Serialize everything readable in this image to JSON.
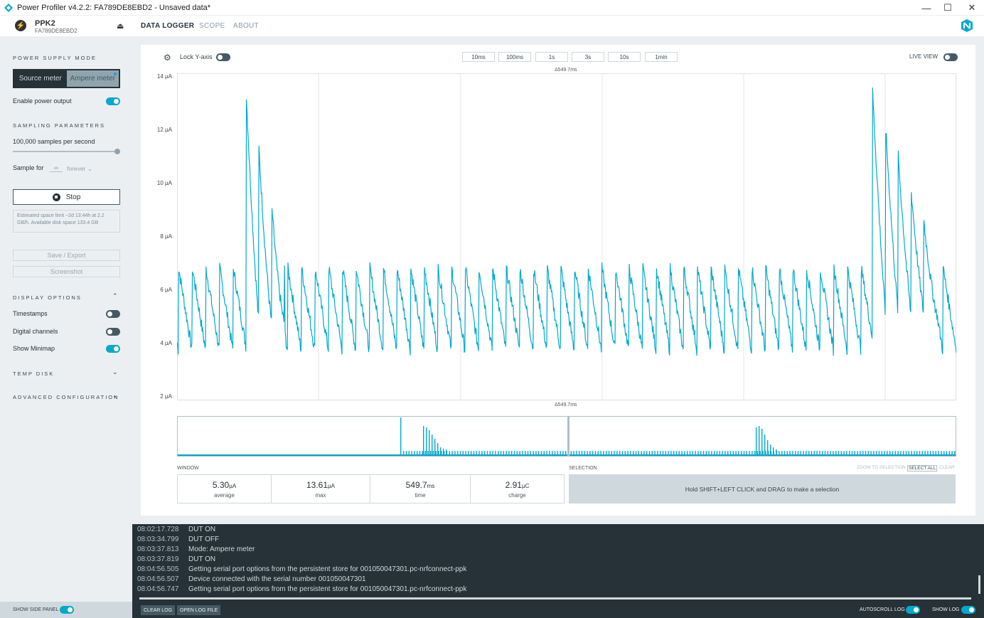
{
  "window": {
    "title": "Power Profiler v4.2.2: FA789DE8EBD2 - Unsaved data*",
    "minimize": "—",
    "maximize": "☐",
    "close": "✕"
  },
  "header": {
    "device_name": "PPK2",
    "device_serial": "FA789DE8EBD2",
    "eject": "⏏",
    "tabs": [
      {
        "label": "DATA LOGGER",
        "active": true
      },
      {
        "label": "SCOPE",
        "active": false
      },
      {
        "label": "ABOUT",
        "active": false
      }
    ]
  },
  "sidebar": {
    "power_supply_title": "POWER SUPPLY MODE",
    "mode_source": "Source meter",
    "mode_ampere": "Ampere meter",
    "enable_power_output": "Enable power output",
    "enable_power_output_on": true,
    "sampling_title": "SAMPLING PARAMETERS",
    "samples_per_second": "100,000 samples per second",
    "sample_for": "Sample for",
    "sample_for_value": "∞",
    "sample_for_unit": "forever",
    "stop_label": "Stop",
    "space_info": "Estimated space limit ~2d 13:44h at 2.2 GB/h. Available disk space 133.4 GB",
    "save_export": "Save / Export",
    "screenshot": "Screenshot",
    "display_options_title": "DISPLAY OPTIONS",
    "timestamps": "Timestamps",
    "timestamps_on": false,
    "digital_channels": "Digital channels",
    "digital_channels_on": false,
    "show_minimap": "Show Minimap",
    "show_minimap_on": true,
    "temp_disk_title": "TEMP DISK",
    "advanced_title": "ADVANCED CONFIGURATION"
  },
  "chart_toolbar": {
    "lock_y_axis": "Lock Y-axis",
    "lock_y_axis_on": false,
    "windows": [
      "10ms",
      "100ms",
      "1s",
      "3s",
      "10s",
      "1min"
    ],
    "live_view": "LIVE VIEW",
    "live_view_on": false,
    "delta_top": "Δ549.7ms",
    "delta_bottom": "Δ549.7ms"
  },
  "chart_data": {
    "type": "line",
    "title": "",
    "xlabel": "",
    "ylabel": "",
    "y_unit": "µA",
    "y_ticks": [
      "14 µA",
      "12 µA",
      "10 µA",
      "8 µA",
      "6 µA",
      "4 µA",
      "2 µA"
    ],
    "ylim": [
      2,
      14
    ],
    "x_span_ms": 549.7,
    "color": "#00a9ce",
    "description_of_pattern": "sawtooth",
    "baseline_low": 3.8,
    "baseline_high": 6.9,
    "burst_peaks": [
      13.5,
      12.0
    ]
  },
  "stats": {
    "window_title": "WINDOW",
    "average_value": "5.30",
    "average_unit": "µA",
    "average_label": "average",
    "max_value": "13.61",
    "max_unit": "µA",
    "max_label": "max",
    "time_value": "549.7",
    "time_unit": "ms",
    "time_label": "time",
    "charge_value": "2.91",
    "charge_unit": "µC",
    "charge_label": "charge",
    "selection_title": "SELECTION",
    "zoom_to_selection": "ZOOM TO SELECTION",
    "select_all": "SELECT ALL",
    "clear": "CLEAR",
    "selection_hint": "Hold SHIFT+LEFT CLICK and DRAG to make a selection"
  },
  "log": [
    {
      "time": "08:02:17.728",
      "msg": "DUT ON"
    },
    {
      "time": "08:03:34.799",
      "msg": "DUT OFF"
    },
    {
      "time": "08:03:37.813",
      "msg": "Mode: Ampere meter"
    },
    {
      "time": "08:03:37.819",
      "msg": "DUT ON"
    },
    {
      "time": "08:04:56.505",
      "msg": "Getting serial port options from the persistent store for 001050047301.pc-nrfconnect-ppk"
    },
    {
      "time": "08:04:56.507",
      "msg": "Device connected with the serial number 001050047301"
    },
    {
      "time": "08:04:56.747",
      "msg": "Getting serial port options from the persistent store for 001050047301.pc-nrfconnect-ppk"
    }
  ],
  "bottom": {
    "show_side_panel": "SHOW SIDE PANEL",
    "clear_log": "CLEAR LOG",
    "open_log_file": "OPEN LOG FILE",
    "autoscroll_log": "AUTOSCROLL LOG",
    "show_log": "SHOW LOG"
  },
  "colors": {
    "accent": "#00a9ce",
    "dark": "#263238",
    "sidebar_bg": "#eceff1"
  }
}
